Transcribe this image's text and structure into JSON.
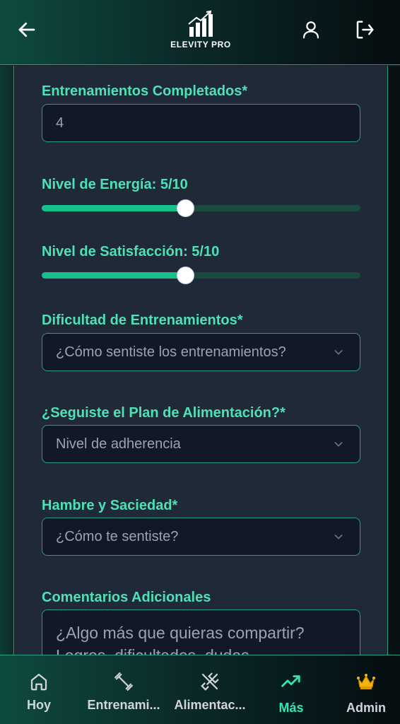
{
  "header": {
    "logo_text": "ELEVITY PRO"
  },
  "form": {
    "workouts_completed": {
      "label": "Entrenamientos Completados*",
      "value": "4"
    },
    "energy": {
      "label": "Nivel de Energía: 5/10",
      "value": 5,
      "max": 10,
      "fill_fraction": 0.45
    },
    "satisfaction": {
      "label": "Nivel de Satisfacción: 5/10",
      "value": 5,
      "max": 10,
      "fill_fraction": 0.45
    },
    "difficulty": {
      "label": "Dificultad de Entrenamientos*",
      "placeholder": "¿Cómo sentiste los entrenamientos?"
    },
    "meal_plan": {
      "label": "¿Seguiste el Plan de Alimentación?*",
      "placeholder": "Nivel de adherencia"
    },
    "hunger": {
      "label": "Hambre y Saciedad*",
      "placeholder": "¿Cómo te sentiste?"
    },
    "comments": {
      "label": "Comentarios Adicionales",
      "placeholder": "¿Algo más que quieras compartir? Logros, dificultades, dudas..."
    }
  },
  "nav": {
    "items": [
      {
        "label": "Hoy",
        "icon": "home-icon"
      },
      {
        "label": "Entrenami...",
        "icon": "dumbbell-icon"
      },
      {
        "label": "Alimentac...",
        "icon": "utensils-icon"
      },
      {
        "label": "Más",
        "icon": "trending-up-icon",
        "active": true
      },
      {
        "label": "Admin",
        "icon": "crown-icon"
      }
    ]
  },
  "colors": {
    "accent": "#4fe0b6",
    "active_nav": "#2ee6b8",
    "slider_fill": "#16c08a",
    "card_bg": "#1f2937",
    "input_bg": "#111827",
    "border": "#2a9d82"
  }
}
